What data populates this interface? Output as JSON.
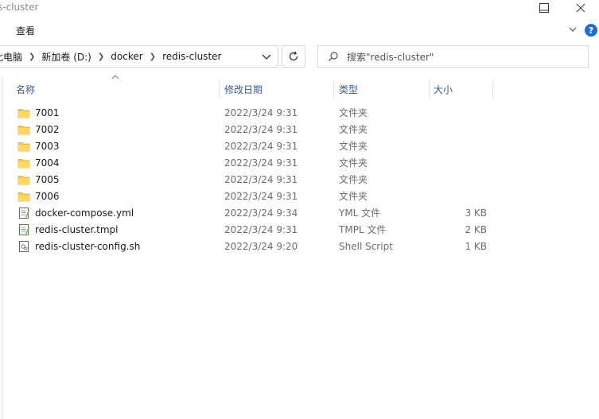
{
  "window": {
    "title": "redis-cluster"
  },
  "ribbon": {
    "view_tab": "查看"
  },
  "address": {
    "crumbs": [
      "此电脑",
      "新加卷 (D:)",
      "docker",
      "redis-cluster"
    ]
  },
  "search": {
    "placeholder": "搜索\"redis-cluster\""
  },
  "columns": {
    "name": "名称",
    "date": "修改日期",
    "type": "类型",
    "size": "大小"
  },
  "files": [
    {
      "name": "7001",
      "date": "2022/3/24 9:31",
      "type": "文件夹",
      "size": "",
      "icon": "folder-icon"
    },
    {
      "name": "7002",
      "date": "2022/3/24 9:31",
      "type": "文件夹",
      "size": "",
      "icon": "folder-icon"
    },
    {
      "name": "7003",
      "date": "2022/3/24 9:31",
      "type": "文件夹",
      "size": "",
      "icon": "folder-icon"
    },
    {
      "name": "7004",
      "date": "2022/3/24 9:31",
      "type": "文件夹",
      "size": "",
      "icon": "folder-icon"
    },
    {
      "name": "7005",
      "date": "2022/3/24 9:31",
      "type": "文件夹",
      "size": "",
      "icon": "folder-icon"
    },
    {
      "name": "7006",
      "date": "2022/3/24 9:31",
      "type": "文件夹",
      "size": "",
      "icon": "folder-icon"
    },
    {
      "name": "docker-compose.yml",
      "date": "2022/3/24 9:34",
      "type": "YML 文件",
      "size": "3 KB",
      "icon": "text-file-icon"
    },
    {
      "name": "redis-cluster.tmpl",
      "date": "2022/3/24 9:31",
      "type": "TMPL 文件",
      "size": "2 KB",
      "icon": "text-file-icon"
    },
    {
      "name": "redis-cluster-config.sh",
      "date": "2022/3/24 9:20",
      "type": "Shell Script",
      "size": "1 KB",
      "icon": "script-file-icon"
    }
  ]
}
